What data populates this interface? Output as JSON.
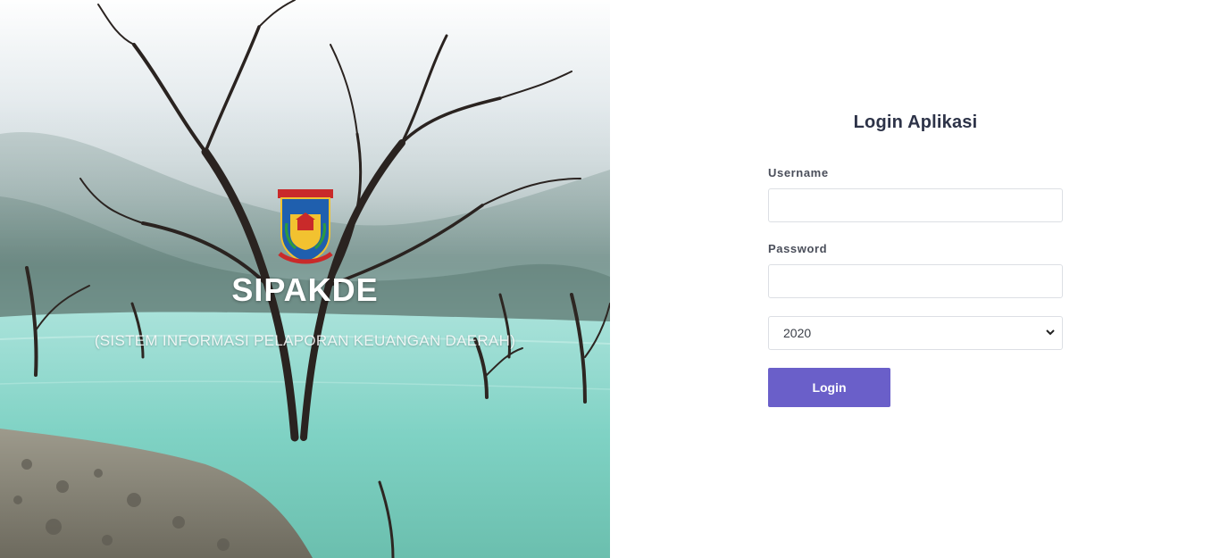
{
  "hero": {
    "logo_text_top": "KOTA TANGERANG SELATAN",
    "logo_text_bottom": "CERDAS MODERN RELIGIUS",
    "title": "SIPAKDE",
    "subtitle": "(SISTEM INFORMASI PELAPORAN KEUANGAN DAERAH)"
  },
  "login": {
    "title": "Login Aplikasi",
    "username_label": "Username",
    "username_value": "",
    "password_label": "Password",
    "password_value": "",
    "year_selected": "2020",
    "submit_label": "Login"
  },
  "colors": {
    "accent": "#6a5fc9",
    "title_text": "#2d3348",
    "input_border": "#dcdfe4"
  }
}
